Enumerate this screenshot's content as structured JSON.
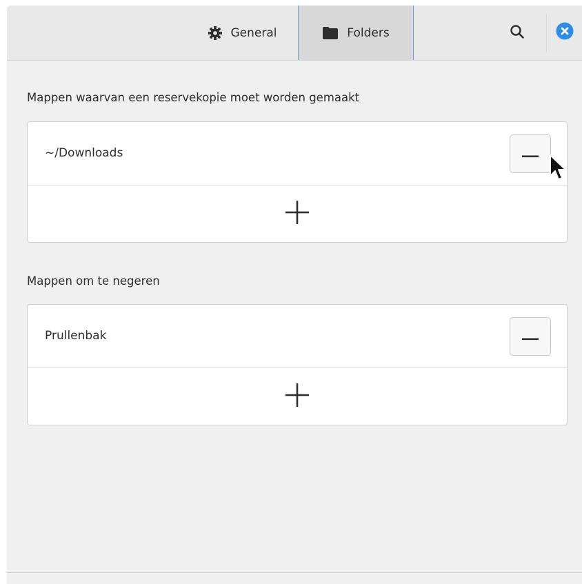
{
  "header": {
    "tabs": [
      {
        "label": "General",
        "icon": "gear-icon",
        "active": false
      },
      {
        "label": "Folders",
        "icon": "folder-icon",
        "active": true
      }
    ],
    "search_icon": "search-icon",
    "close_icon": "close-icon",
    "close_color": "#2d8de6"
  },
  "backup": {
    "label": "Mappen waarvan een reservekopie moet worden gemaakt",
    "items": [
      "~/Downloads"
    ],
    "remove_icon": "minus-icon",
    "add_icon": "plus-icon"
  },
  "ignore": {
    "label": "Mappen om te negeren",
    "items": [
      "Prullenbak"
    ],
    "remove_icon": "minus-icon",
    "add_icon": "plus-icon"
  },
  "colors": {
    "accent": "#6aa0d6",
    "active_tab_bg": "#d8d8d8",
    "header_bg": "#e9e9e9"
  }
}
